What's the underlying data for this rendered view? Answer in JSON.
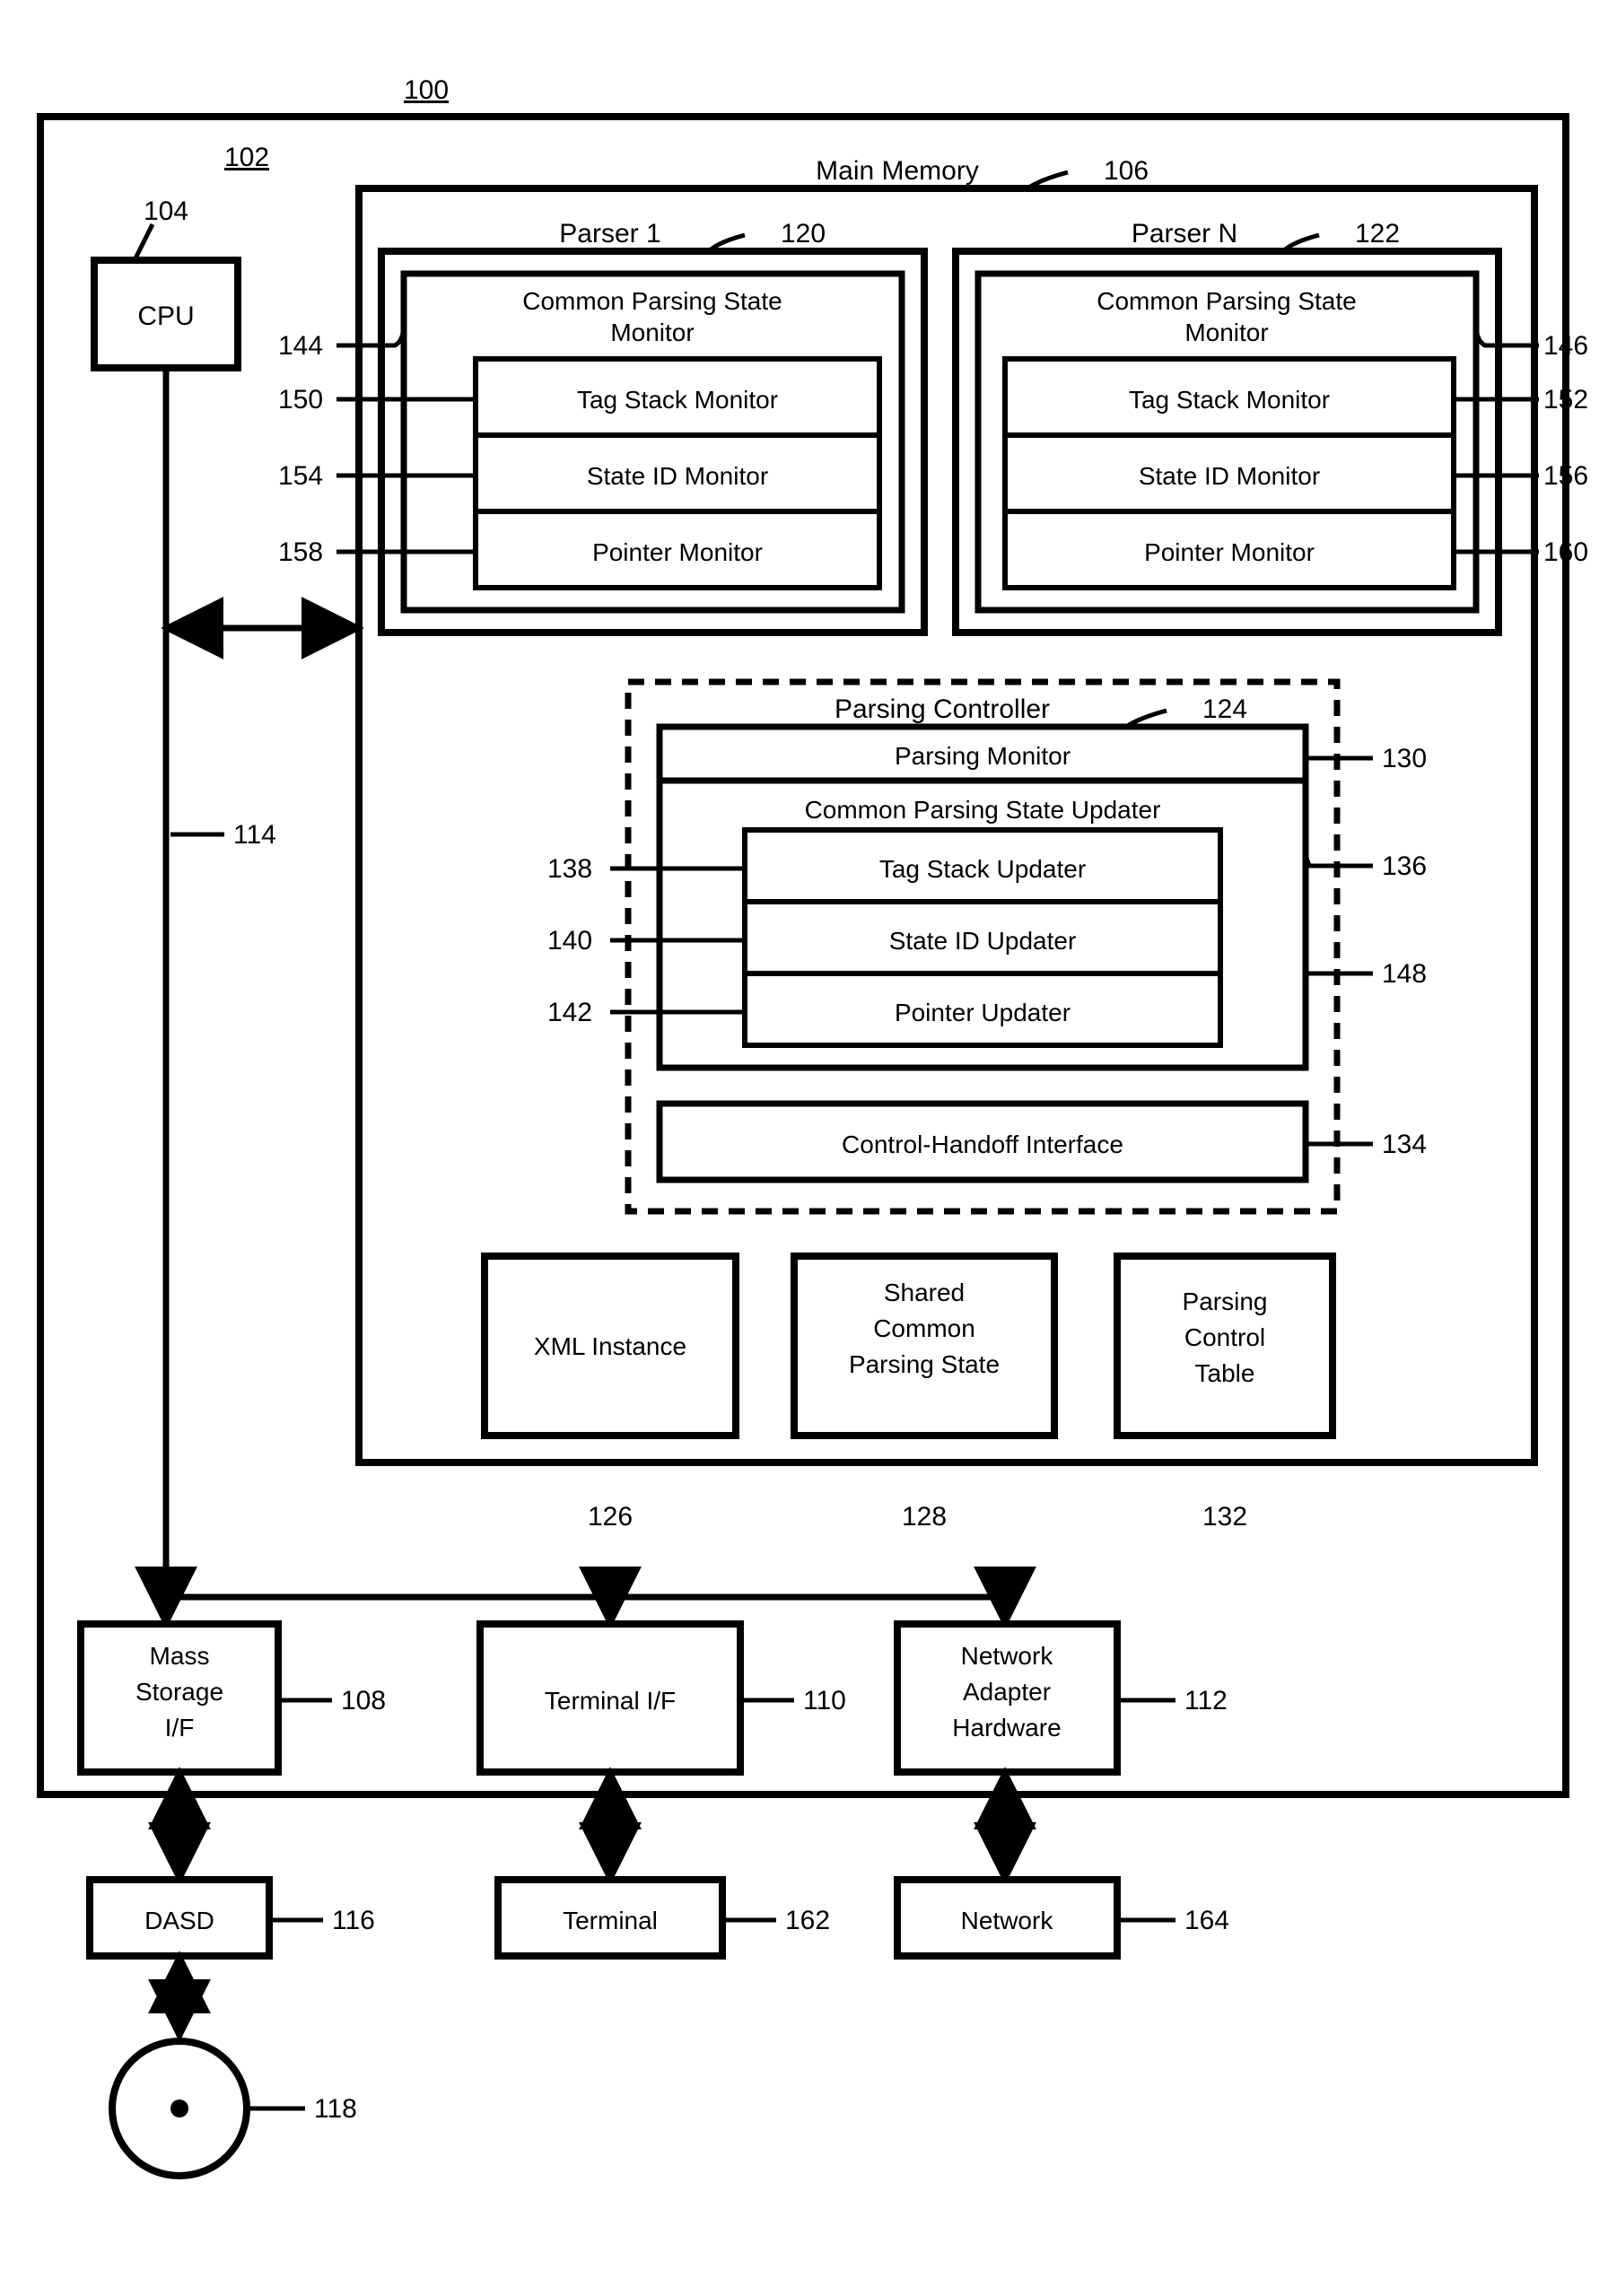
{
  "refs": {
    "system": "100",
    "board": "102",
    "cpu": "104",
    "mainMemory": "106",
    "massStorage": "108",
    "terminalIf": "110",
    "networkHw": "112",
    "bus": "114",
    "dasd": "116",
    "disk": "118",
    "parser1": "120",
    "parserN": "122",
    "parsingController": "124",
    "xmlInstance": "126",
    "sharedState": "128",
    "parsingMonitor": "130",
    "controlTable": "132",
    "handoff": "134",
    "updater": "136",
    "tagUpdater": "138",
    "stateIdUpdater": "140",
    "pointerUpdater": "142",
    "monitor1": "144",
    "monitorN": "146",
    "updaterBox": "148",
    "tagMon1": "150",
    "tagMonN": "152",
    "stateMon1": "154",
    "stateMonN": "156",
    "ptrMon1": "158",
    "ptrMonN": "160",
    "terminal": "162",
    "network": "164"
  },
  "labels": {
    "cpu": "CPU",
    "mainMemory": "Main Memory",
    "parser1": "Parser 1",
    "parserN": "Parser N",
    "commonMonitor1a": "Common Parsing State",
    "commonMonitor1b": "Monitor",
    "tagStackMonitor": "Tag Stack Monitor",
    "stateIdMonitor": "State ID Monitor",
    "pointerMonitor": "Pointer Monitor",
    "parsingController": "Parsing Controller",
    "parsingMonitor": "Parsing Monitor",
    "commonUpdater": "Common Parsing State Updater",
    "tagStackUpdater": "Tag Stack Updater",
    "stateIdUpdater": "State ID Updater",
    "pointerUpdater": "Pointer Updater",
    "handoff": "Control-Handoff Interface",
    "xmlInstance": "XML Instance",
    "shared1": "Shared",
    "shared2": "Common",
    "shared3": "Parsing State",
    "ctrl1": "Parsing",
    "ctrl2": "Control",
    "ctrl3": "Table",
    "mass1": "Mass",
    "mass2": "Storage",
    "mass3": "I/F",
    "terminalIf": "Terminal I/F",
    "net1": "Network",
    "net2": "Adapter",
    "net3": "Hardware",
    "dasd": "DASD",
    "terminal": "Terminal",
    "network": "Network"
  }
}
